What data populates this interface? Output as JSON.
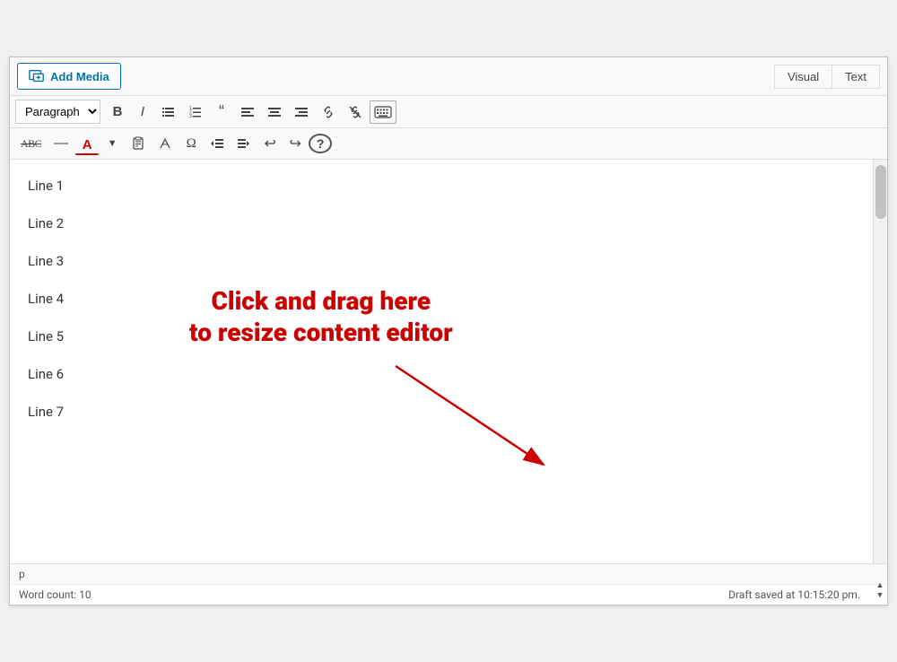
{
  "topBar": {
    "addMediaLabel": "Add Media",
    "tabs": [
      {
        "label": "Visual",
        "active": false
      },
      {
        "label": "Text",
        "active": false
      }
    ]
  },
  "toolbar1": {
    "paragraphSelect": "Paragraph",
    "buttons": [
      {
        "id": "bold",
        "label": "B",
        "title": "Bold"
      },
      {
        "id": "italic",
        "label": "I",
        "title": "Italic"
      },
      {
        "id": "ul",
        "label": "≡•",
        "title": "Unordered List"
      },
      {
        "id": "ol",
        "label": "≡1",
        "title": "Ordered List"
      },
      {
        "id": "blockquote",
        "label": "❝",
        "title": "Blockquote"
      },
      {
        "id": "align-left",
        "label": "⬛",
        "title": "Align Left"
      },
      {
        "id": "align-center",
        "label": "▥",
        "title": "Align Center"
      },
      {
        "id": "align-right",
        "label": "▦",
        "title": "Align Right"
      },
      {
        "id": "link",
        "label": "🔗",
        "title": "Insert Link"
      },
      {
        "id": "unlink",
        "label": "🔗—",
        "title": "Remove Link"
      },
      {
        "id": "keyboard",
        "label": "⌨",
        "title": "Keyboard"
      }
    ]
  },
  "toolbar2": {
    "buttons": [
      {
        "id": "strikethrough",
        "label": "ABC̶",
        "title": "Strikethrough"
      },
      {
        "id": "hr",
        "label": "—",
        "title": "Horizontal Rule"
      },
      {
        "id": "text-color",
        "label": "A",
        "title": "Text Color"
      },
      {
        "id": "color-dropdown",
        "label": "▼",
        "title": "Color Dropdown"
      },
      {
        "id": "paste-text",
        "label": "📋T",
        "title": "Paste as Text"
      },
      {
        "id": "clear-format",
        "label": "◇",
        "title": "Clear Formatting"
      },
      {
        "id": "special-char",
        "label": "Ω",
        "title": "Special Characters"
      },
      {
        "id": "outdent",
        "label": "⇤",
        "title": "Outdent"
      },
      {
        "id": "indent",
        "label": "⇥",
        "title": "Indent"
      },
      {
        "id": "undo",
        "label": "↩",
        "title": "Undo"
      },
      {
        "id": "redo",
        "label": "↪",
        "title": "Redo"
      },
      {
        "id": "help",
        "label": "?",
        "title": "Help"
      }
    ]
  },
  "editor": {
    "lines": [
      {
        "id": 1,
        "text": "Line 1"
      },
      {
        "id": 2,
        "text": "Line 2"
      },
      {
        "id": 3,
        "text": "Line 3"
      },
      {
        "id": 4,
        "text": "Line 4"
      },
      {
        "id": 5,
        "text": "Line 5"
      },
      {
        "id": 6,
        "text": "Line 6"
      },
      {
        "id": 7,
        "text": "Line 7"
      }
    ],
    "annotation": {
      "line1": "Click and drag here",
      "line2": "to resize content editor"
    }
  },
  "statusBar": {
    "tag": "p",
    "wordCountLabel": "Word count: 10",
    "draftStatus": "Draft saved at 10:15:20 pm."
  }
}
